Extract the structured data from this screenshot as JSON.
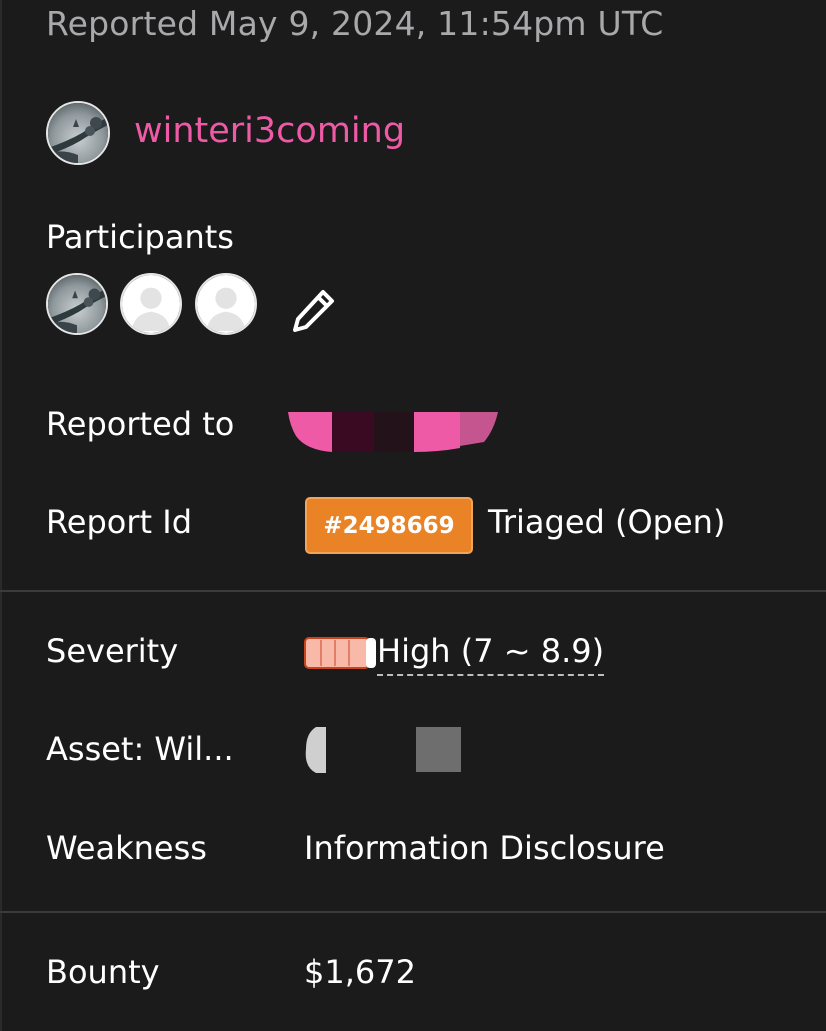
{
  "header": {
    "reported_at": "Reported May 9, 2024, 11:54pm UTC"
  },
  "reporter": {
    "username": "winteri3coming",
    "avatar_icon": "landscape-avatar-icon"
  },
  "participants": {
    "label": "Participants",
    "avatars": [
      "landscape-avatar-icon",
      "default-user-icon",
      "default-user-icon"
    ],
    "edit_icon": "pencil-icon"
  },
  "details": {
    "reported_to_label": "Reported to",
    "report_id_label": "Report Id",
    "report_id": "#2498669",
    "status": "Triaged (Open)"
  },
  "classification": {
    "severity_label": "Severity",
    "severity_value": "High (7 ~ 8.9)",
    "asset_label": "Asset: Wil...",
    "weakness_label": "Weakness",
    "weakness_value": "Information Disclosure"
  },
  "reward": {
    "bounty_label": "Bounty",
    "bounty_value": "$1,672"
  },
  "colors": {
    "background": "#1b1b1c",
    "username": "#ee5aa6",
    "badge": "#e98325",
    "severity_fill": "#f9b9a8",
    "divider": "#3b3b3c"
  }
}
